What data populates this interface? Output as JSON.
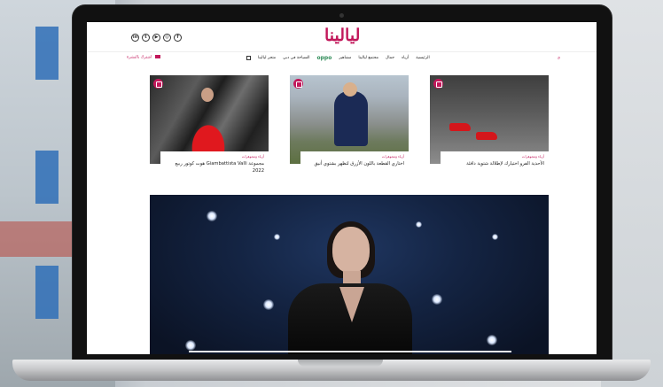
{
  "site": {
    "logo": "ليالينا",
    "social_icons": [
      "linkedin-icon",
      "twitter-icon",
      "youtube-icon",
      "instagram-icon",
      "facebook-icon"
    ],
    "nav_left_label": "اشترك بالنشرة",
    "nav_items": [
      "الرئيسية",
      "أزياء",
      "جمال",
      "مجتمع ليالينا",
      "مشاهير",
      "oppo",
      "السياحة في دبي",
      "متجر ليالينا"
    ],
    "accent": "#c2185b"
  },
  "cards": [
    {
      "category": "أزياء ومجوهرات",
      "title": "مجموعة Giambattista Valli هوت كوتور ربيع 2022"
    },
    {
      "category": "أزياء ومجوهرات",
      "title": "اختاري القطعة باللون الأزرق لتظهر بشتوي أنيق"
    },
    {
      "category": "أزياء ومجوهرات",
      "title": "الأحذية الفرو اختيارك لإطلالة شتوية دافئة"
    }
  ]
}
